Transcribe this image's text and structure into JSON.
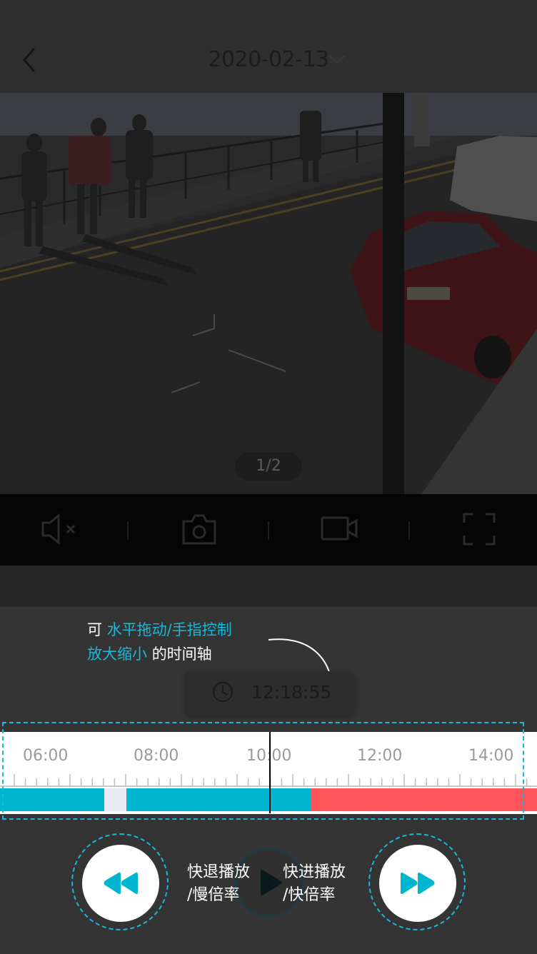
{
  "header": {
    "date": "2020-02-13",
    "back_icon": "chevron-left-icon",
    "caret_icon": "chevron-down-icon"
  },
  "video": {
    "page_indicator": "1/2"
  },
  "toolbar": {
    "items": [
      {
        "name": "mute-icon"
      },
      {
        "name": "camera-icon"
      },
      {
        "name": "video-record-icon"
      },
      {
        "name": "fullscreen-icon"
      }
    ]
  },
  "annotation": {
    "line1_prefix": "可",
    "line1_highlight": "水平拖动/手指控制",
    "line2_highlight": "放大缩小",
    "line2_suffix": "的时间轴"
  },
  "time_bubble": {
    "time": "12:18:55"
  },
  "timeline": {
    "ticks": [
      "06:00",
      "08:00",
      "10:00",
      "12:00",
      "14:00"
    ],
    "colors": {
      "normal": "#00b5d0",
      "alarm": "#ff5459",
      "empty": "#eaeaf2"
    }
  },
  "controls": {
    "rewind_label_1": "快退播放",
    "rewind_label_2": "/慢倍率",
    "forward_label_1": "快进播放",
    "forward_label_2": "/快倍率"
  },
  "colors": {
    "accent": "#1ab8d8",
    "background": "#343434"
  }
}
